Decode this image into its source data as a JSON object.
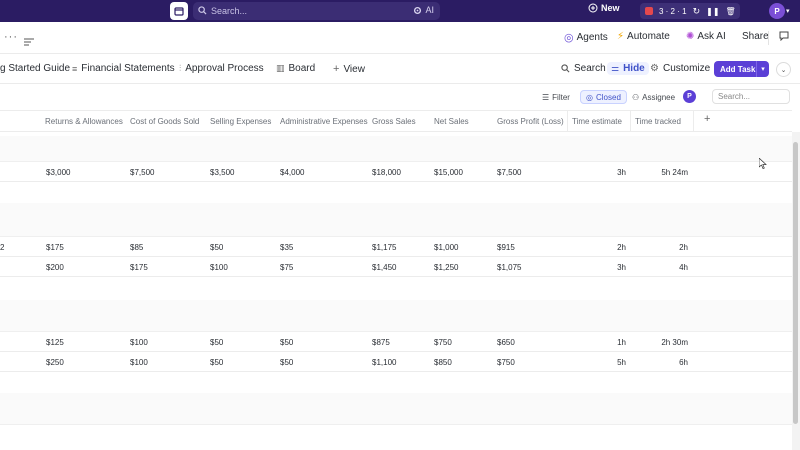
{
  "topbar": {
    "search_placeholder": "Search...",
    "ai_label": "AI",
    "new_label": "New",
    "record_counts": "3 · 2 · 1",
    "avatar_initial": "P"
  },
  "toolbar": {
    "agents_label": "Agents",
    "automate_label": "Automate",
    "ask_ai_label": "Ask AI",
    "share_label": "Share"
  },
  "view_tabs": [
    {
      "label": "g Started Guide"
    },
    {
      "label": "Financial Statements"
    },
    {
      "label": "Approval Process"
    },
    {
      "label": "Board"
    },
    {
      "label": "View"
    }
  ],
  "view_actions": {
    "search_label": "Search",
    "hide_label": "Hide",
    "customize_label": "Customize",
    "add_task_label": "Add Task"
  },
  "filters": {
    "filter_label": "Filter",
    "closed_label": "Closed",
    "assignee_label": "Assignee",
    "assignee_initial": "P",
    "search_placeholder": "Search..."
  },
  "columns": [
    "Returns & Allowances",
    "Cost of Goods Sold",
    "Selling Expenses",
    "Administrative Expenses",
    "Gross Sales",
    "Net Sales",
    "Gross Profit (Loss)",
    "Time estimate",
    "Time tracked"
  ],
  "rows": [
    {
      "prefix": "",
      "values": [
        "$3,000",
        "$7,500",
        "$3,500",
        "$4,000",
        "$18,000",
        "$15,000",
        "$7,500"
      ],
      "estimate": "3h",
      "tracked": "5h 24m"
    },
    {
      "prefix": "2",
      "values": [
        "$175",
        "$85",
        "$50",
        "$35",
        "$1,175",
        "$1,000",
        "$915"
      ],
      "estimate": "2h",
      "tracked": "2h"
    },
    {
      "prefix": "",
      "values": [
        "$200",
        "$175",
        "$100",
        "$75",
        "$1,450",
        "$1,250",
        "$1,075"
      ],
      "estimate": "3h",
      "tracked": "4h"
    },
    {
      "prefix": "",
      "values": [
        "$125",
        "$100",
        "$50",
        "$50",
        "$875",
        "$750",
        "$650"
      ],
      "estimate": "1h",
      "tracked": "2h 30m"
    },
    {
      "prefix": "",
      "values": [
        "$250",
        "$100",
        "$50",
        "$50",
        "$1,100",
        "$850",
        "$750"
      ],
      "estimate": "5h",
      "tracked": "6h"
    }
  ],
  "colors": {
    "brand": "#2b1c63",
    "accent": "#5b3fd6",
    "record": "#e5484d"
  }
}
